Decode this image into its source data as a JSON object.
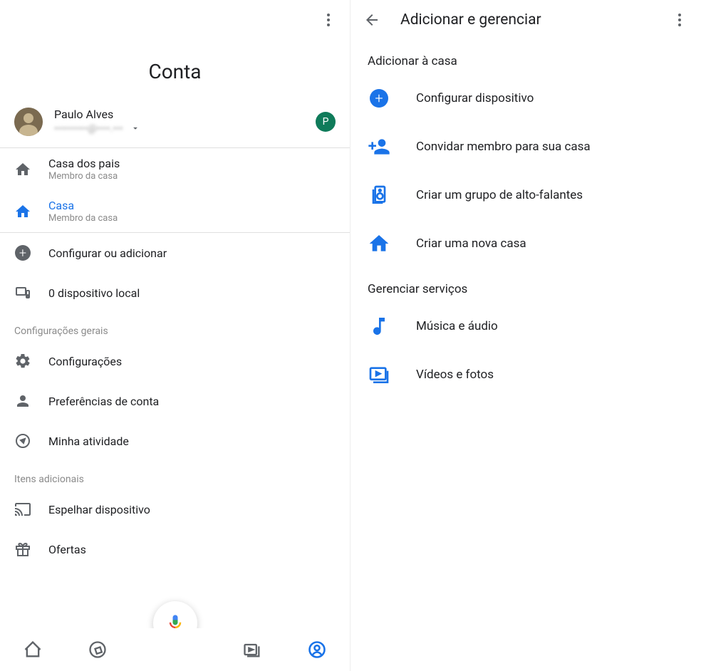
{
  "left": {
    "page_title": "Conta",
    "account": {
      "name": "Paulo Alves",
      "email": "••••••••••@••••.•••",
      "badge_initial": "P"
    },
    "homes": [
      {
        "title": "Casa dos pais",
        "sub": "Membro da casa",
        "active": false
      },
      {
        "title": "Casa",
        "sub": "Membro da casa",
        "active": true
      }
    ],
    "quick": [
      {
        "title": "Configurar ou adicionar",
        "icon": "plus-circle"
      },
      {
        "title": "0 dispositivo local",
        "icon": "device-local"
      }
    ],
    "sections": [
      {
        "header": "Configurações gerais",
        "items": [
          {
            "title": "Configurações",
            "icon": "gear"
          },
          {
            "title": "Preferências de conta",
            "icon": "person"
          },
          {
            "title": "Minha atividade",
            "icon": "compass-outline"
          }
        ]
      },
      {
        "header": "Itens adicionais",
        "items": [
          {
            "title": "Espelhar dispositivo",
            "icon": "cast"
          },
          {
            "title": "Ofertas",
            "icon": "gift"
          }
        ]
      }
    ],
    "nav": [
      {
        "icon": "home",
        "active": false
      },
      {
        "icon": "compass",
        "active": false
      },
      {
        "icon": "media",
        "active": false
      },
      {
        "icon": "account",
        "active": true
      }
    ]
  },
  "right": {
    "title": "Adicionar e gerenciar",
    "sections": [
      {
        "header": "Adicionar à casa",
        "items": [
          {
            "label": "Configurar dispositivo",
            "icon": "plus-circle-blue"
          },
          {
            "label": "Convidar membro para sua casa",
            "icon": "person-add"
          },
          {
            "label": "Criar um grupo de alto-falantes",
            "icon": "speaker-group"
          },
          {
            "label": "Criar uma nova casa",
            "icon": "home-blue"
          }
        ]
      },
      {
        "header": "Gerenciar serviços",
        "items": [
          {
            "label": "Música e áudio",
            "icon": "music-note"
          },
          {
            "label": "Vídeos e fotos",
            "icon": "video-photo"
          }
        ]
      }
    ]
  }
}
